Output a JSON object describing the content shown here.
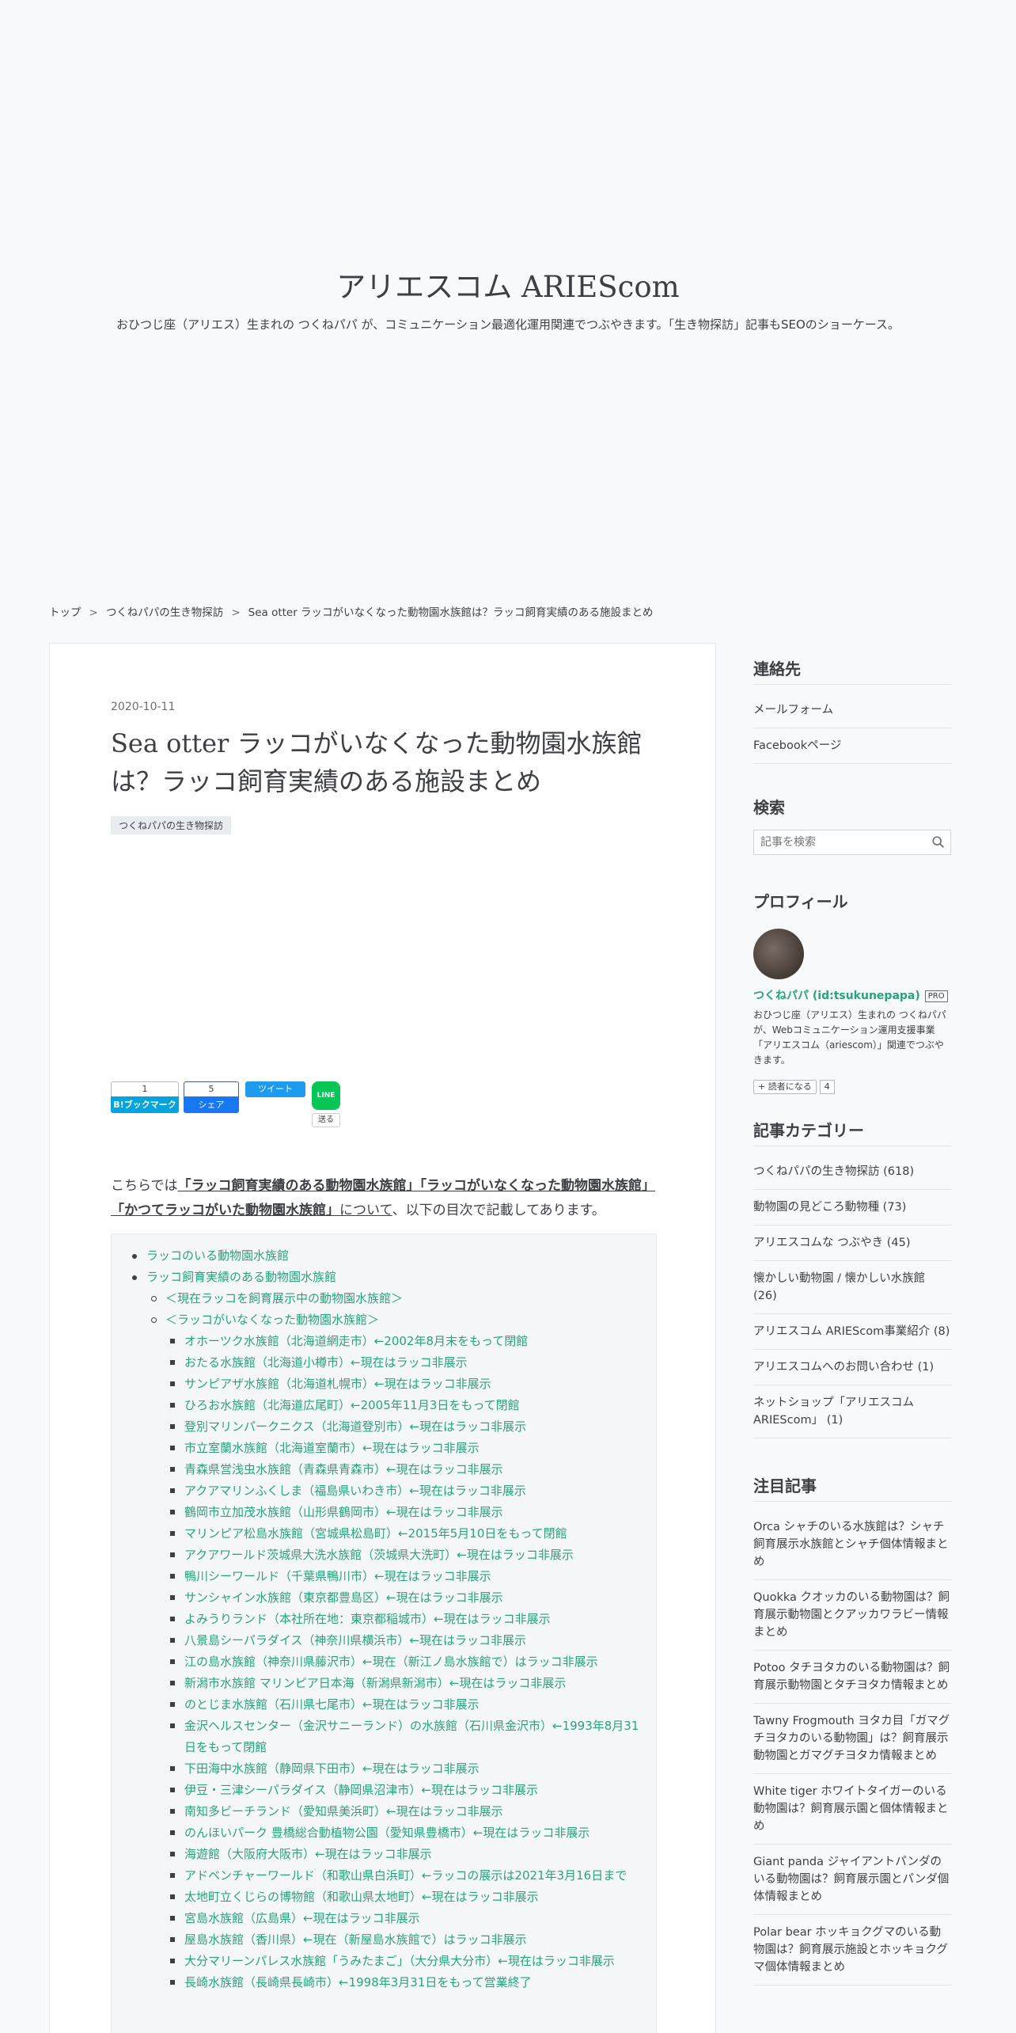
{
  "header": {
    "title": "アリエスコム ARIEScom",
    "description": "おひつじ座（アリエス）生まれの つくねパパ が、コミュニケーション最適化運用関連でつぶやきます。「生き物探訪」記事もSEOのショーケース。"
  },
  "breadcrumb": {
    "items": [
      "トップ",
      "つくねパパの生き物探訪",
      "Sea otter ラッコがいなくなった動物園水族館は？ラッコ飼育実績のある施設まとめ"
    ],
    "separator": ">"
  },
  "entry": {
    "date": "2020-10-11",
    "title": "Sea otter ラッコがいなくなった動物園水族館は？ラッコ飼育実績のある施設まとめ",
    "category": "つくねパパの生き物探訪",
    "share": {
      "hatena_count": "1",
      "hatena_label": "B!ブックマーク",
      "fb_count": "5",
      "fb_label": "シェア",
      "twitter_label": "ツイート",
      "line_icon": "LINE",
      "line_label": "送る"
    },
    "intro": {
      "prefix": "こちらでは",
      "b1": "「ラッコ飼育実績のある動物園水族館」",
      "b2": "「ラッコがいなくなった動物園水族館」",
      "b3": "「かつてラッコがいた動物園水族館」",
      "mid": "について",
      "suffix": "、以下の目次で記載してあります。"
    },
    "toc": {
      "top": [
        "ラッコのいる動物園水族館",
        "ラッコ飼育実績のある動物園水族館"
      ],
      "sub": [
        "＜現在ラッコを飼育展示中の動物園水族館＞",
        "＜ラッコがいなくなった動物園水族館＞"
      ],
      "items": [
        "オホーツク水族館（北海道網走市）←2002年8月末をもって閉館",
        "おたる水族館（北海道小樽市）←現在はラッコ非展示",
        "サンピアザ水族館（北海道札幌市）←現在はラッコ非展示",
        "ひろお水族館（北海道広尾町）←2005年11月3日をもって閉館",
        "登別マリンパークニクス（北海道登別市）←現在はラッコ非展示",
        "市立室蘭水族館（北海道室蘭市）←現在はラッコ非展示",
        "青森県営浅虫水族館（青森県青森市）←現在はラッコ非展示",
        "アクアマリンふくしま（福島県いわき市）←現在はラッコ非展示",
        "鶴岡市立加茂水族館（山形県鶴岡市）←現在はラッコ非展示",
        "マリンピア松島水族館（宮城県松島町）←2015年5月10日をもって閉館",
        "アクアワールド茨城県大洗水族館（茨城県大洗町）←現在はラッコ非展示",
        "鴨川シーワールド（千葉県鴨川市）←現在はラッコ非展示",
        "サンシャイン水族館（東京都豊島区）←現在はラッコ非展示",
        "よみうりランド（本社所在地：東京都稲城市）←現在はラッコ非展示",
        "八景島シーパラダイス（神奈川県横浜市）←現在はラッコ非展示",
        "江の島水族館（神奈川県藤沢市）←現在（新江ノ島水族館で）はラッコ非展示",
        "新潟市水族館 マリンピア日本海（新潟県新潟市）←現在はラッコ非展示",
        "のとじま水族館（石川県七尾市）←現在はラッコ非展示",
        "金沢ヘルスセンター（金沢サニーランド）の水族館（石川県金沢市）←1993年8月31日をもって閉館",
        "下田海中水族館（静岡県下田市）←現在はラッコ非展示",
        "伊豆・三津シーパラダイス（静岡県沼津市）←現在はラッコ非展示",
        "南知多ビーチランド（愛知県美浜町）←現在はラッコ非展示",
        "のんほいパーク 豊橋総合動植物公園（愛知県豊橋市）←現在はラッコ非展示",
        "海遊館（大阪府大阪市）←現在はラッコ非展示",
        "アドベンチャーワールド（和歌山県白浜町）←ラッコの展示は2021年3月16日まで",
        "太地町立くじらの博物館（和歌山県太地町）←現在はラッコ非展示",
        "宮島水族館（広島県）←現在はラッコ非展示",
        "屋島水族館（香川県）←現在（新屋島水族館で）はラッコ非展示",
        "大分マリーンパレス水族館「うみたまご」（大分県大分市）←現在はラッコ非展示",
        "長崎水族館（長崎県長崎市）←1998年3月31日をもって営業終了"
      ]
    }
  },
  "sidebar": {
    "contact": {
      "heading": "連絡先",
      "items": [
        "メールフォーム",
        "Facebookページ"
      ]
    },
    "search": {
      "heading": "検索",
      "placeholder": "記事を検索"
    },
    "profile": {
      "heading": "プロフィール",
      "name": "つくねパパ (id:tsukunepapa)",
      "badge": "PRO",
      "description": "おひつじ座（アリエス）生まれの つくねパパ が、Webコミュニケーション運用支援事業「アリエスコム（ariescom）」関連でつぶやきます。",
      "reader_button": "読者になる",
      "reader_count": "4"
    },
    "categories": {
      "heading": "記事カテゴリー",
      "items": [
        "つくねパパの生き物探訪 (618)",
        "動物園の見どころ動物種 (73)",
        "アリエスコムな つぶやき (45)",
        "懐かしい動物園 / 懐かしい水族館 (26)",
        "アリエスコム ARIEScom事業紹介 (8)",
        "アリエスコムへのお問い合わせ (1)",
        "ネットショップ「アリエスコム ARIEScom」 (1)"
      ]
    },
    "featured": {
      "heading": "注目記事",
      "items": [
        "Orca シャチのいる水族館は？シャチ飼育展示水族館とシャチ個体情報まとめ",
        "Quokka クオッカのいる動物園は？飼育展示動物園とクアッカワラビー情報まとめ",
        "Potoo タチヨタカのいる動物園は？飼育展示動物園とタチヨタカ情報まとめ",
        "Tawny Frogmouth ヨタカ目「ガマグチヨタカのいる動物園」は？飼育展示動物園とガマグチヨタカ情報まとめ",
        "White tiger ホワイトタイガーのいる動物園は？飼育展示園と個体情報まとめ",
        "Giant panda ジャイアントパンダのいる動物園は？飼育展示園とパンダ個体情報まとめ",
        "Polar bear ホッキョクグマのいる動物園は？飼育展示施設とホッキョクグマ個体情報まとめ"
      ]
    }
  }
}
